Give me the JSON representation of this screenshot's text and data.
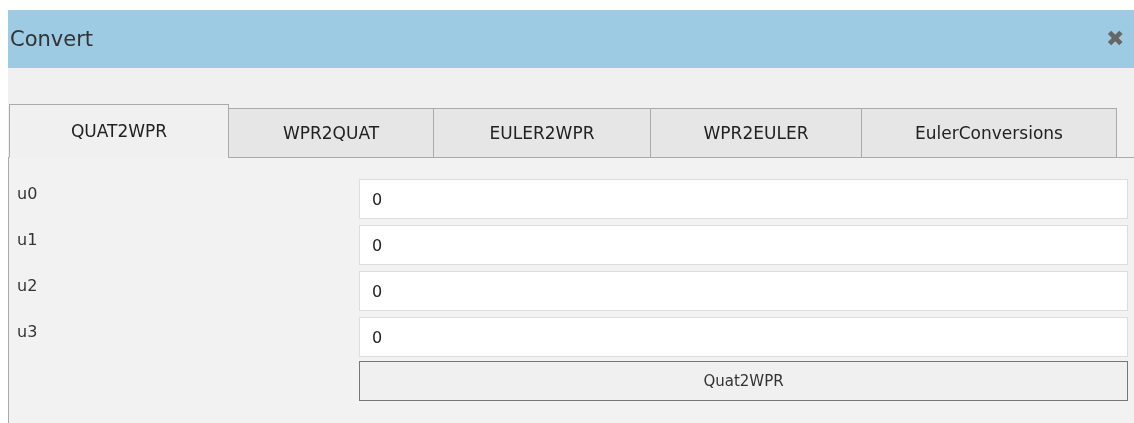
{
  "window": {
    "title": "Convert",
    "close": "✖"
  },
  "tabs": [
    {
      "label": "QUAT2WPR",
      "selected": true
    },
    {
      "label": "WPR2QUAT",
      "selected": false
    },
    {
      "label": "EULER2WPR",
      "selected": false
    },
    {
      "label": "WPR2EULER",
      "selected": false
    },
    {
      "label": "EulerConversions",
      "selected": false
    }
  ],
  "fields": [
    {
      "label": "u0",
      "value": "0"
    },
    {
      "label": "u1",
      "value": "0"
    },
    {
      "label": "u2",
      "value": "0"
    },
    {
      "label": "u3",
      "value": "0"
    }
  ],
  "button": "Quat2WPR"
}
